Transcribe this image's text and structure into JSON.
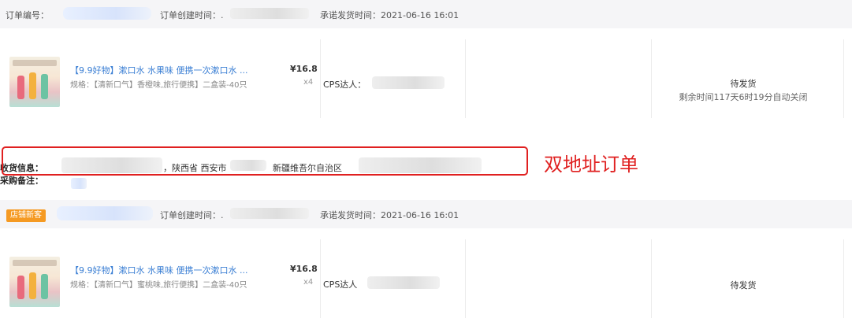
{
  "order1": {
    "header": {
      "order_no_label": "订单编号：",
      "created_label": "订单创建时间：.",
      "promise_label": "承诺发货时间：2021-06-16 16:01"
    },
    "product": {
      "title": "【9.9好物】漱口水 水果味 便携一次漱口水 ...",
      "spec": "规格：【清新口气】香橙味,旅行便携】二盒装-40只",
      "price": "¥16.8",
      "qty": "x4",
      "cps_label": "CPS达人："
    },
    "status": "待发货",
    "countdown": "剩余时间117天6时19分自动关闭"
  },
  "shipping": {
    "label": "收货信息：",
    "province_city": "，陕西省 西安市",
    "region": "新疆维吾尔自治区",
    "remark_label": "采购备注："
  },
  "annotation": {
    "text": "双地址订单",
    "color": "#e02020"
  },
  "order2": {
    "tag": "店铺新客",
    "header": {
      "created_label": "订单创建时间：.",
      "promise_label": "承诺发货时间：2021-06-16 16:01"
    },
    "product": {
      "title": "【9.9好物】漱口水 水果味 便携一次漱口水 ...",
      "spec": "规格：【清新口气】蜜桃味,旅行便携】二盒装-40只",
      "price": "¥16.8",
      "qty": "x4",
      "cps_label": "CPS达人"
    },
    "status": "待发货"
  }
}
